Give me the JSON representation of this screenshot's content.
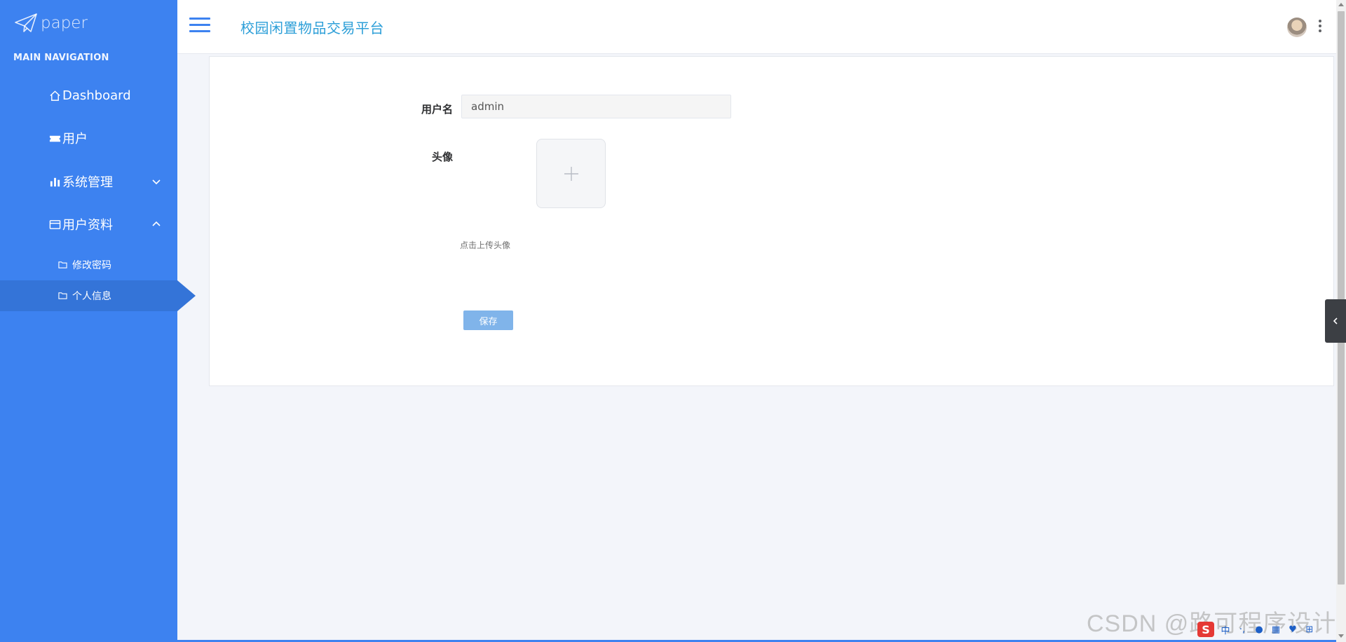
{
  "sidebar": {
    "logo_text": "paper",
    "nav_heading": "MAIN NAVIGATION",
    "items": [
      {
        "label": "Dashboard",
        "icon": "home-icon"
      },
      {
        "label": "用户",
        "icon": "ticket-icon"
      },
      {
        "label": "系统管理",
        "icon": "bar-chart-icon",
        "expanded": false
      },
      {
        "label": "用户资料",
        "icon": "card-icon",
        "expanded": true
      }
    ],
    "sub_items": [
      {
        "label": "修改密码",
        "icon": "folder-icon",
        "active": false
      },
      {
        "label": "个人信息",
        "icon": "folder-icon",
        "active": true
      }
    ]
  },
  "header": {
    "title": "校园闲置物品交易平台"
  },
  "form": {
    "username_label": "用户名",
    "username_value": "admin",
    "avatar_label": "头像",
    "upload_hint": "点击上传头像",
    "save_label": "保存"
  },
  "watermark": "CSDN @路可程序设计",
  "colors": {
    "sidebar_bg": "#3d82f0",
    "sidebar_active": "#3474d8",
    "title": "#2d9fd8",
    "save_button": "#80b4ea"
  }
}
